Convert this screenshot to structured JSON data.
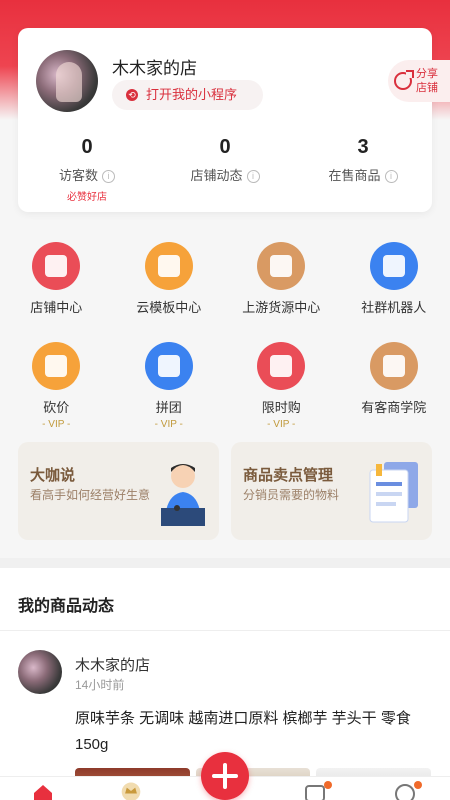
{
  "shop": {
    "name": "木木家的店",
    "open_mini_program": "打开我的小程序",
    "share_label": "分享店铺"
  },
  "stats": [
    {
      "value": "0",
      "label": "访客数",
      "sub": "必赞好店"
    },
    {
      "value": "0",
      "label": "店铺动态",
      "sub": ""
    },
    {
      "value": "3",
      "label": "在售商品",
      "sub": ""
    }
  ],
  "grid": {
    "row1": [
      {
        "label": "店铺中心",
        "icon": "store-icon",
        "color": "#ea4d57"
      },
      {
        "label": "云模板中心",
        "icon": "template-icon",
        "color": "#f6a23a"
      },
      {
        "label": "上游货源中心",
        "icon": "box-icon",
        "color": "#d99a63"
      },
      {
        "label": "社群机器人",
        "icon": "robot-icon",
        "color": "#3b82f0"
      }
    ],
    "row2": [
      {
        "label": "砍价",
        "icon": "bargain-icon",
        "color": "#f6a23a",
        "badge": "- VIP -"
      },
      {
        "label": "拼团",
        "icon": "group-buy-icon",
        "color": "#3b82f0",
        "badge": "- VIP -"
      },
      {
        "label": "限时购",
        "icon": "flash-sale-icon",
        "color": "#ea4d57",
        "badge": "- VIP -"
      },
      {
        "label": "有客商学院",
        "icon": "crown-icon",
        "color": "#d99a63",
        "badge": ""
      }
    ]
  },
  "promos": [
    {
      "title": "大咖说",
      "subtitle": "看高手如何经营好生意"
    },
    {
      "title": "商品卖点管理",
      "subtitle": "分销员需要的物料"
    }
  ],
  "feed": {
    "title": "我的商品动态",
    "post": {
      "author": "木木家的店",
      "time": "14小时前",
      "text": "原味芋条 无调味 越南进口原料 槟榔芋 芋头干 零食 150g"
    }
  }
}
